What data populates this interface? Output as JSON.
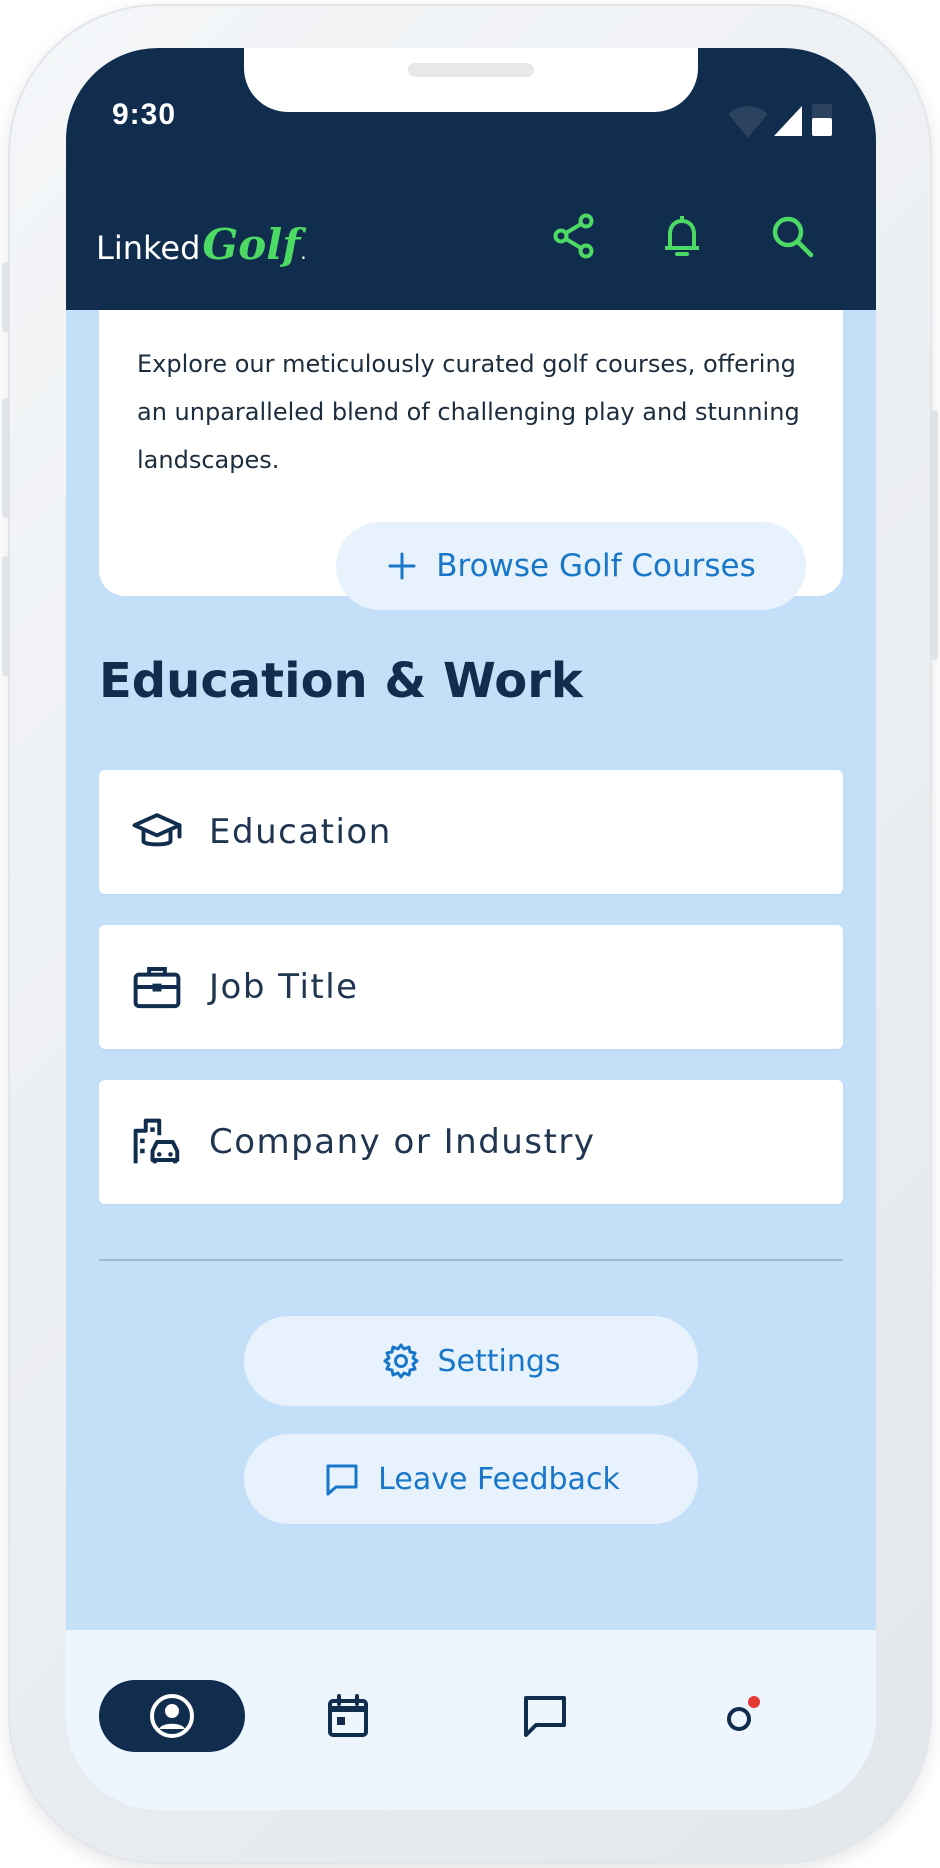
{
  "status_bar": {
    "time": "9:30"
  },
  "header": {
    "logo_linked": "Linked",
    "logo_golf": "Golf",
    "icons": [
      "share-icon",
      "bell-icon",
      "search-icon"
    ]
  },
  "courses_card": {
    "description": "Explore our meticulously curated golf courses, offering an unparalleled blend of challenging play and stunning landscapes.",
    "browse_button": "Browse Golf Courses"
  },
  "education_work": {
    "title": "Education & Work",
    "fields": [
      {
        "label": "Education",
        "icon": "graduation-cap-icon"
      },
      {
        "label": "Job Title",
        "icon": "briefcase-icon"
      },
      {
        "label": "Company or Industry",
        "icon": "buildings-icon"
      }
    ]
  },
  "actions": {
    "settings": "Settings",
    "feedback": "Leave Feedback"
  },
  "bottom_nav": {
    "items": [
      "profile-icon",
      "calendar-icon",
      "chat-icon",
      "notifications-icon"
    ],
    "active": "profile-icon"
  },
  "colors": {
    "navy": "#112d4e",
    "accent_green": "#4cd964",
    "link_blue": "#1877c9",
    "page_bg": "#c4e0f9",
    "pill_bg": "#e8f2fc",
    "notification_dot": "#e53935"
  }
}
